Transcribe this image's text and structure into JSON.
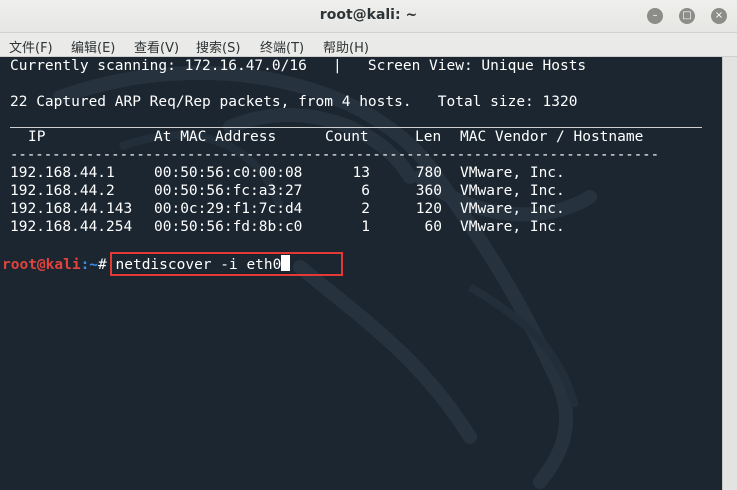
{
  "window": {
    "title": "root@kali: ~",
    "buttons": {
      "minimize_glyph": "–",
      "maximize_glyph": "□",
      "close_glyph": "×"
    }
  },
  "menu": [
    "文件(F)",
    "编辑(E)",
    "查看(V)",
    "搜索(S)",
    "终端(T)",
    "帮助(H)"
  ],
  "terminal": {
    "header_line": "Currently scanning: 172.16.47.0/16   |   Screen View: Unique Hosts",
    "summary_line": "22 Captured ARP Req/Rep packets, from 4 hosts.   Total size: 1320",
    "columns": [
      "IP",
      "At MAC Address",
      "Count",
      "Len",
      "MAC Vendor / Hostname"
    ],
    "dash_line": "-----------------------------------------------------------------------------",
    "rows": [
      {
        "ip": "192.168.44.1",
        "mac": "00:50:56:c0:00:08",
        "count": "13",
        "len": "780",
        "vendor": "VMware, Inc."
      },
      {
        "ip": "192.168.44.2",
        "mac": "00:50:56:fc:a3:27",
        "count": "6",
        "len": "360",
        "vendor": "VMware, Inc."
      },
      {
        "ip": "192.168.44.143",
        "mac": "00:0c:29:f1:7c:d4",
        "count": "2",
        "len": "120",
        "vendor": "VMware, Inc."
      },
      {
        "ip": "192.168.44.254",
        "mac": "00:50:56:fd:8b:c0",
        "count": "1",
        "len": "60",
        "vendor": "VMware, Inc."
      }
    ],
    "prompt": {
      "user_host": "root@kali",
      "path": ":~",
      "symbol": "#",
      "command": " netdiscover -i eth0"
    }
  },
  "colors": {
    "terminal_bg": "#1b2630",
    "prompt_user": "#e2433c",
    "prompt_path": "#3b8eea",
    "highlight_box": "#e53935"
  }
}
